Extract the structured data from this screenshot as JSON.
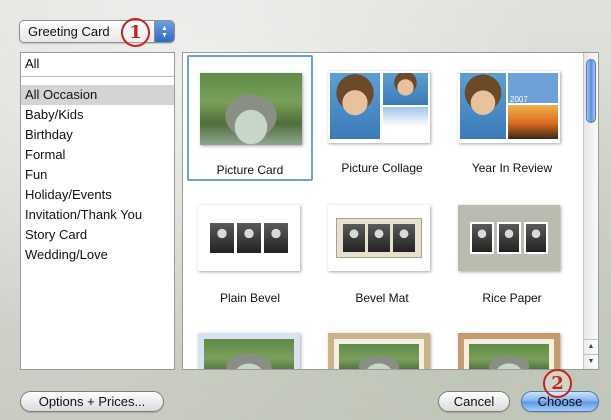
{
  "popup": {
    "label": "Greeting Card"
  },
  "callouts": [
    "1",
    "2"
  ],
  "categories": {
    "all": "All",
    "items": [
      "All Occasion",
      "Baby/Kids",
      "Birthday",
      "Formal",
      "Fun",
      "Holiday/Events",
      "Invitation/Thank You",
      "Story Card",
      "Wedding/Love"
    ],
    "selected": "All Occasion"
  },
  "templates": {
    "items": [
      "Picture Card",
      "Picture Collage",
      "Year In Review",
      "Plain Bevel",
      "Bevel Mat",
      "Rice Paper"
    ],
    "selected": "Picture Card",
    "year_badge": "2007"
  },
  "buttons": {
    "options": "Options + Prices...",
    "cancel": "Cancel",
    "choose": "Choose"
  },
  "colors": {
    "selection_border": "#6c9ee0",
    "callout": "#c8221b",
    "default_button": "#5c96e6"
  }
}
